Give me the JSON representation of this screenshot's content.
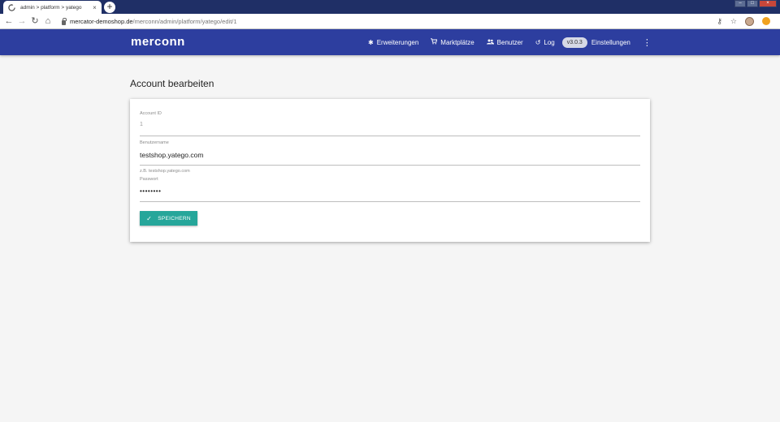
{
  "browser": {
    "tab_title": "admin > platform > yatego",
    "new_tab_label": "+",
    "url_host": "mercator-demoshop.de",
    "url_path": "/merconn/admin/platform/yatego/edit/1",
    "icons": [
      "back-icon",
      "forward-icon",
      "reload-icon",
      "home-icon",
      "key-icon",
      "star-icon",
      "profile-avatar",
      "extension-icon"
    ]
  },
  "appbar": {
    "logo": "merconn",
    "nav": [
      {
        "icon": "puzzle-icon",
        "glyph": "✱",
        "label": "Erweiterungen"
      },
      {
        "icon": "cart-icon",
        "glyph": "🛒",
        "label": "Marktplätze"
      },
      {
        "icon": "users-icon",
        "glyph": "👥",
        "label": "Benutzer"
      },
      {
        "icon": "log-icon",
        "glyph": "↺",
        "label": "Log"
      }
    ],
    "version": "v3.0.3",
    "settings_label": "Einstellungen"
  },
  "page": {
    "title": "Account bearbeiten"
  },
  "form": {
    "account_id_label": "Account ID",
    "account_id_value": "1",
    "username_label": "Benutzername",
    "username_value": "testshop.yatego.com",
    "username_hint": "z.B. testshop.yatego.com",
    "password_label": "Passwort",
    "password_value": "••••••••",
    "save_label": "SPEICHERN"
  },
  "colors": {
    "appbar": "#2d3e9f",
    "save_button": "#26a69a"
  }
}
